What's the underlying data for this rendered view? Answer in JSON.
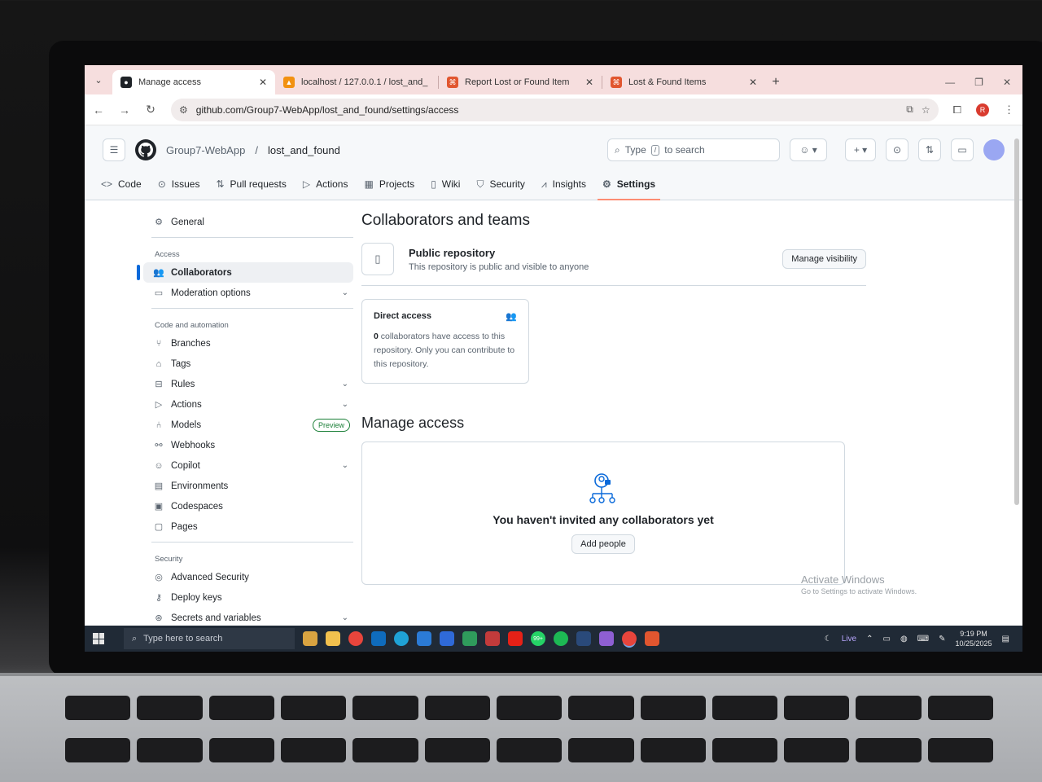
{
  "browser": {
    "tabs": [
      {
        "title": "Manage access",
        "active": true
      },
      {
        "title": "localhost / 127.0.0.1 / lost_and_",
        "active": false
      },
      {
        "title": "Report Lost or Found Item",
        "active": false
      },
      {
        "title": "Lost & Found Items",
        "active": false
      }
    ],
    "url": "github.com/Group7-WebApp/lost_and_found/settings/access",
    "profile_initial": "R"
  },
  "header": {
    "owner": "Group7-WebApp",
    "separator": "/",
    "repo": "lost_and_found",
    "search_prefix": "Type",
    "search_key": "/",
    "search_suffix": "to search"
  },
  "repo_tabs": [
    {
      "label": "Code",
      "icon": "code-icon"
    },
    {
      "label": "Issues",
      "icon": "issue-icon"
    },
    {
      "label": "Pull requests",
      "icon": "pull-request-icon"
    },
    {
      "label": "Actions",
      "icon": "play-icon"
    },
    {
      "label": "Projects",
      "icon": "table-icon"
    },
    {
      "label": "Wiki",
      "icon": "book-icon"
    },
    {
      "label": "Security",
      "icon": "shield-icon"
    },
    {
      "label": "Insights",
      "icon": "graph-icon"
    },
    {
      "label": "Settings",
      "icon": "gear-icon"
    }
  ],
  "sidebar": {
    "general": "General",
    "access_heading": "Access",
    "collaborators": "Collaborators",
    "moderation": "Moderation options",
    "code_heading": "Code and automation",
    "code_items": {
      "branches": "Branches",
      "tags": "Tags",
      "rules": "Rules",
      "actions": "Actions",
      "models": "Models",
      "models_badge": "Preview",
      "webhooks": "Webhooks",
      "copilot": "Copilot",
      "environments": "Environments",
      "codespaces": "Codespaces",
      "pages": "Pages"
    },
    "security_heading": "Security",
    "security_items": {
      "advanced": "Advanced Security",
      "deploy": "Deploy keys",
      "secrets": "Secrets and variables"
    }
  },
  "main": {
    "title": "Collaborators and teams",
    "public_title": "Public repository",
    "public_desc": "This repository is public and visible to anyone",
    "manage_visibility": "Manage visibility",
    "direct_access_title": "Direct access",
    "direct_count": "0",
    "direct_text": "collaborators have access to this repository. Only you can contribute to this repository.",
    "manage_access_title": "Manage access",
    "empty_title": "You haven't invited any collaborators yet",
    "add_people": "Add people"
  },
  "watermark": {
    "line1": "Activate Windows",
    "line2": "Go to Settings to activate Windows."
  },
  "taskbar": {
    "search_placeholder": "Type here to search",
    "live": "Live",
    "time": "9:19 PM",
    "date": "10/25/2025",
    "badge": "99+"
  }
}
